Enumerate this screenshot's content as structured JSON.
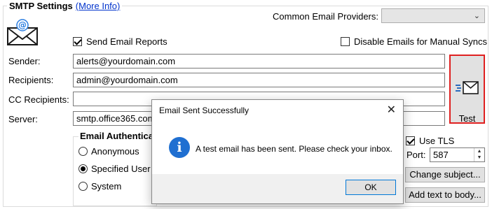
{
  "smtp": {
    "title": "SMTP Settings",
    "more_info": "(More Info)",
    "providers_label": "Common Email Providers:",
    "providers_value": "",
    "send_reports_label": "Send Email Reports",
    "send_reports_checked": true,
    "disable_manual_label": "Disable Emails for Manual Syncs",
    "disable_manual_checked": false,
    "sender_label": "Sender:",
    "sender_value": "alerts@yourdomain.com",
    "recipients_label": "Recipients:",
    "recipients_value": "admin@yourdomain.com",
    "cc_label": "CC Recipients:",
    "cc_value": "",
    "server_label": "Server:",
    "server_value": "smtp.office365.com",
    "test_label": "Test",
    "use_tls_label": "Use TLS",
    "use_tls_checked": true,
    "port_label": "Port:",
    "port_value": "587",
    "change_subject_label": "Change subject...",
    "add_text_label": "Add text to body..."
  },
  "auth": {
    "title": "Email Authentica",
    "options": [
      "Anonymous",
      "Specified User",
      "System"
    ],
    "selected": "Specified User"
  },
  "dialog": {
    "title": "Email Sent Successfully",
    "message": "A test email has been sent. Please check your inbox.",
    "ok_label": "OK"
  }
}
